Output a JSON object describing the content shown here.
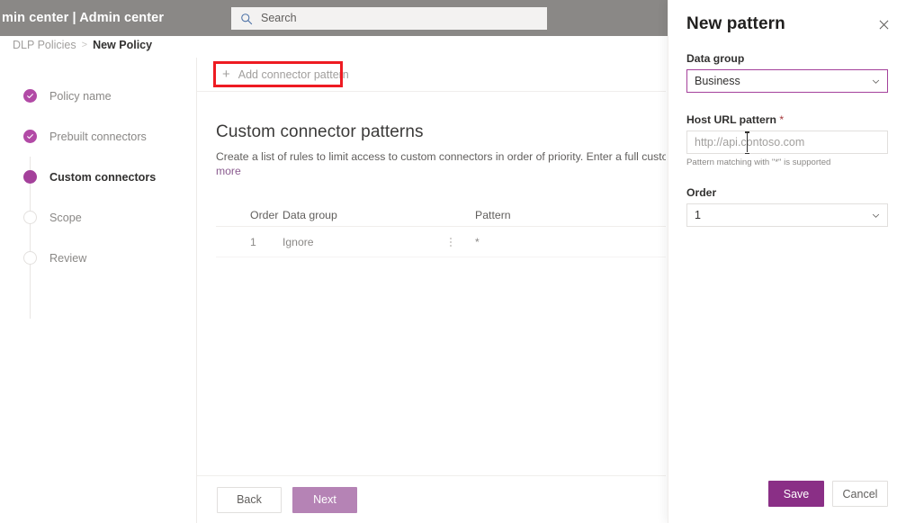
{
  "suitebar": {
    "title": "min center  |  Admin center",
    "search": {
      "placeholder": "Search",
      "icon": "search-icon"
    }
  },
  "breadcrumb": {
    "parent": "DLP Policies",
    "separator": ">",
    "current": "New Policy"
  },
  "wizard": {
    "steps": [
      {
        "label": "Policy name",
        "state": "done"
      },
      {
        "label": "Prebuilt connectors",
        "state": "done"
      },
      {
        "label": "Custom connectors",
        "state": "active"
      },
      {
        "label": "Scope",
        "state": "todo"
      },
      {
        "label": "Review",
        "state": "todo"
      }
    ]
  },
  "command_bar": {
    "add_pattern_label": "Add connector pattern",
    "add_pattern_icon": "plus-icon",
    "highlight_color": "#ee1b22"
  },
  "main": {
    "heading": "Custom connector patterns",
    "description": "Create a list of rules to limit access to custom connectors in order of priority. Enter a full custom connector U",
    "description_link": "more",
    "table": {
      "columns": [
        "Order",
        "Data group",
        "Pattern"
      ],
      "rows": [
        {
          "order": "1",
          "data_group": "Ignore",
          "pattern": "*",
          "menu_icon": "kebab-menu-icon"
        }
      ]
    },
    "footer": {
      "back_label": "Back",
      "next_label": "Next",
      "next_color": "#b583b5"
    }
  },
  "flyout": {
    "title": "New pattern",
    "close_icon": "close-icon",
    "fields": {
      "data_group": {
        "label": "Data group",
        "value": "Business",
        "icon": "chevron-down-icon",
        "focus_color": "#a4419b"
      },
      "host_url": {
        "label": "Host URL pattern",
        "required_marker": "*",
        "placeholder": "http://api.contoso.com",
        "hint": "Pattern matching with \"*\" is supported"
      },
      "order": {
        "label": "Order",
        "value": "1",
        "icon": "chevron-down-icon"
      }
    },
    "actions": {
      "save_label": "Save",
      "cancel_label": "Cancel",
      "save_color": "#8a2f86"
    }
  }
}
